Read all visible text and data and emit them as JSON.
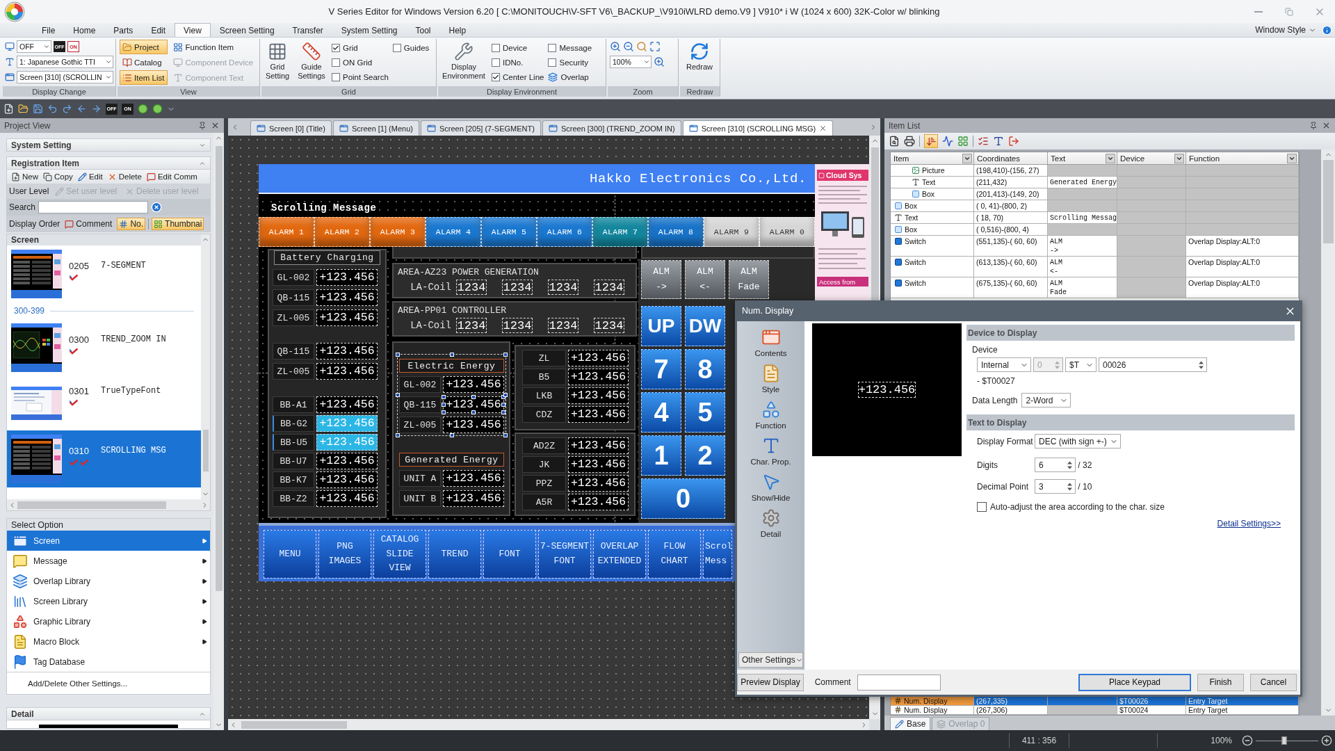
{
  "window": {
    "title": "V Series Editor for Windows Version 6.20 [ C:\\MONITOUCH\\V-SFT V6\\_BACKUP_\\V910iWLRD demo.V9 ] V910* i W (1024 x 600) 32K-Color w/ blinking"
  },
  "menu": {
    "items": [
      {
        "label": "File",
        "selected": false
      },
      {
        "label": "Home",
        "selected": false
      },
      {
        "label": "Parts",
        "selected": false
      },
      {
        "label": "Edit",
        "selected": false
      },
      {
        "label": "View",
        "selected": true
      },
      {
        "label": "Screen Setting",
        "selected": false
      },
      {
        "label": "Transfer",
        "selected": false
      },
      {
        "label": "System Setting",
        "selected": false
      },
      {
        "label": "Tool",
        "selected": false
      },
      {
        "label": "Help",
        "selected": false
      }
    ],
    "window_style": "Window Style"
  },
  "ribbon": {
    "display_change": {
      "label": "Display Change",
      "blink": "OFF",
      "toggles": [
        "OFF",
        "ON"
      ],
      "font": "1: Japanese Gothic TTI",
      "screen": "Screen [310] (SCROLLIN"
    },
    "view": {
      "label": "View",
      "items": [
        {
          "label": "Project",
          "kind": "project",
          "selected": true,
          "disabled": false
        },
        {
          "label": "Catalog",
          "kind": "catalog",
          "selected": false,
          "disabled": false
        },
        {
          "label": "Item List",
          "kind": "list",
          "selected": true,
          "disabled": false
        },
        {
          "label": "Function Item",
          "kind": "function",
          "selected": false,
          "disabled": false
        },
        {
          "label": "Component Device",
          "kind": "device",
          "selected": false,
          "disabled": true
        },
        {
          "label": "Component Text",
          "kind": "text",
          "selected": false,
          "disabled": true
        }
      ]
    },
    "grid": {
      "label": "Grid",
      "buttons": [
        {
          "label": "Grid Setting",
          "kind": "grid"
        },
        {
          "label": "Guide Settings",
          "kind": "guide"
        }
      ],
      "checks": [
        {
          "label": "Grid",
          "checked": true
        },
        {
          "label": "ON Grid",
          "checked": false
        },
        {
          "label": "Point Search",
          "checked": false
        },
        {
          "label": "Guides",
          "checked": false
        }
      ]
    },
    "display_environment": {
      "label": "Display Environment",
      "button": "Display Environment",
      "checks": [
        {
          "label": "Device",
          "checked": false
        },
        {
          "label": "IDNo.",
          "checked": false
        },
        {
          "label": "Center Line",
          "checked": true
        },
        {
          "label": "Message",
          "checked": false
        },
        {
          "label": "Security",
          "checked": false
        }
      ],
      "overlap": "Overlap"
    },
    "zoom": {
      "label": "Zoom",
      "value": "100%"
    },
    "redraw": {
      "label": "Redraw",
      "button": "Redraw"
    }
  },
  "quick_toolbar": {
    "toggles": [
      "OFF",
      "ON"
    ]
  },
  "project_view": {
    "title": "Project View",
    "system_setting": {
      "title": "System Setting",
      "expanded": false
    },
    "registration": {
      "title": "Registration Item",
      "expanded": true,
      "tools": [
        {
          "label": "New",
          "kind": "new"
        },
        {
          "label": "Copy",
          "kind": "copy"
        },
        {
          "label": "Edit",
          "kind": "edit"
        },
        {
          "label": "Delete",
          "kind": "delete"
        },
        {
          "label": "Edit Comm",
          "kind": "comment"
        }
      ],
      "user_level": {
        "label": "User Level",
        "tools": [
          {
            "label": "Set user level",
            "kind": "edit",
            "disabled": true
          },
          {
            "label": "Delete user level",
            "kind": "delete",
            "disabled": true
          }
        ]
      },
      "search": {
        "label": "Search"
      },
      "display_order": {
        "label": "Display Order",
        "options": [
          {
            "label": "Comment",
            "kind": "comment",
            "selected": false
          },
          {
            "label": "No.",
            "kind": "number",
            "selected": true
          },
          {
            "label": "Thumbnai",
            "kind": "thumbnail",
            "selected": true
          }
        ]
      }
    },
    "screens": {
      "title": "Screen",
      "items": [
        {
          "kind": "screen",
          "number": "0205",
          "name": "7-SEGMENT",
          "thumbnail": {
            "kind": "dark"
          },
          "selected": false,
          "second_flag": false
        },
        {
          "kind": "group",
          "label": "300-399"
        },
        {
          "kind": "screen",
          "number": "0300",
          "name": "TREND_ZOOM IN",
          "thumbnail": {
            "kind": "chart"
          },
          "selected": false,
          "second_flag": false
        },
        {
          "kind": "screen",
          "number": "0301",
          "name": "TrueTypeFont",
          "thumbnail": {
            "kind": "light"
          },
          "selected": false,
          "second_flag": false
        },
        {
          "kind": "screen",
          "number": "0310",
          "name": "SCROLLING MSG",
          "thumbnail": {
            "kind": "dark"
          },
          "selected": true,
          "second_flag": true
        }
      ]
    },
    "select_option": {
      "title": "Select Option",
      "items": [
        {
          "label": "Screen",
          "kind": "screen",
          "selected": true,
          "submenu": true
        },
        {
          "label": "Message",
          "kind": "message",
          "selected": false,
          "submenu": true
        },
        {
          "label": "Overlap Library",
          "kind": "overlap",
          "selected": false,
          "submenu": true
        },
        {
          "label": "Screen Library",
          "kind": "screen_library",
          "selected": false,
          "submenu": true
        },
        {
          "label": "Graphic Library",
          "kind": "graphic",
          "selected": false,
          "submenu": true
        },
        {
          "label": "Macro Block",
          "kind": "macro",
          "selected": false,
          "submenu": true
        },
        {
          "label": "Tag Database",
          "kind": "tag",
          "selected": false,
          "submenu": false
        }
      ],
      "footer": "Add/Delete Other Settings..."
    },
    "detail": {
      "title": "Detail",
      "expanded": true
    }
  },
  "editor": {
    "tabs": [
      {
        "label": "Screen [0] (Title)",
        "selected": false
      },
      {
        "label": "Screen [1] (Menu)",
        "selected": false
      },
      {
        "label": "Screen [205] (7-SEGMENT)",
        "selected": false
      },
      {
        "label": "Screen [300] (TREND_ZOOM IN)",
        "selected": false
      },
      {
        "label": "Screen [310] (SCROLLING MSG)",
        "selected": true
      }
    ],
    "hmi": {
      "header": "Hakko Electronics Co.,Ltd.",
      "subtitle": "Scrolling Message",
      "alarms": [
        {
          "label": "ALARM 1",
          "color": "#e2680f"
        },
        {
          "label": "ALARM 2",
          "color": "#e2680f"
        },
        {
          "label": "ALARM 3",
          "color": "#e2680f"
        },
        {
          "label": "ALARM 4",
          "color": "#1a78d0"
        },
        {
          "label": "ALARM 5",
          "color": "#1a78d0"
        },
        {
          "label": "ALARM 6",
          "color": "#1a78d0"
        },
        {
          "label": "ALARM 7",
          "color": "#13879e"
        },
        {
          "label": "ALARM 8",
          "color": "#1873c9"
        },
        {
          "label": "ALARM 9",
          "color": "#d6d6d6"
        },
        {
          "label": "ALARM 0",
          "color": "#d6d6d6"
        }
      ],
      "battery": {
        "title": "Battery Charging",
        "groups": [
          {
            "rows": [
              {
                "label": "GL-002",
                "value": "+123.456",
                "highlighted": false
              },
              {
                "label": "QB-115",
                "value": "+123.456",
                "highlighted": false
              },
              {
                "label": "ZL-005",
                "value": "+123.456",
                "highlighted": false
              }
            ]
          },
          {
            "rows": [
              {
                "label": "QB-115",
                "value": "+123.456",
                "highlighted": false
              },
              {
                "label": "ZL-005",
                "value": "+123.456",
                "highlighted": false
              }
            ]
          },
          {
            "rows": [
              {
                "label": "BB-A1",
                "value": "+123.456",
                "highlighted": false
              },
              {
                "label": "BB-G2",
                "value": "+123.456",
                "highlighted": true
              },
              {
                "label": "BB-U5",
                "value": "+123.456",
                "highlighted": true
              },
              {
                "label": "BB-U7",
                "value": "+123.456",
                "highlighted": false
              },
              {
                "label": "BB-K7",
                "value": "+123.456",
                "highlighted": false
              },
              {
                "label": "BB-Z2",
                "value": "+123.456",
                "highlighted": false
              }
            ]
          }
        ]
      },
      "areas": [
        {
          "title": "AREA-AZ23 POWER GENERATION",
          "label": "LA-Coil",
          "values": [
            "1234",
            "1234",
            "1234",
            "1234"
          ]
        },
        {
          "title": "AREA-PP01 CONTROLLER",
          "label": "LA-Coil",
          "values": [
            "1234",
            "1234",
            "1234",
            "1234"
          ]
        }
      ],
      "energy": [
        {
          "title": "Electric Energy",
          "selected": true,
          "rows": [
            {
              "label": "GL-002",
              "value": "+123.456",
              "selected": false
            },
            {
              "label": "QB-115",
              "value": "+123.456",
              "selected": true
            },
            {
              "label": "ZL-005",
              "value": "+123.456",
              "selected": false
            }
          ]
        },
        {
          "title": "Generated Energy",
          "selected": false,
          "rows": [
            {
              "label": "UNIT A",
              "value": "+123.456",
              "selected": false
            },
            {
              "label": "UNIT B",
              "value": "+123.456",
              "selected": false
            }
          ]
        }
      ],
      "value_panels": [
        {
          "rows": [
            {
              "label": "ZL",
              "value": "+123.456"
            },
            {
              "label": "B5",
              "value": "+123.456"
            },
            {
              "label": "LKB",
              "value": "+123.456"
            },
            {
              "label": "CDZ",
              "value": "+123.456"
            }
          ]
        },
        {
          "rows": [
            {
              "label": "AD2Z",
              "value": "+123.456"
            },
            {
              "label": "JK",
              "value": "+123.456"
            },
            {
              "label": "PPZ",
              "value": "+123.456"
            },
            {
              "label": "A5R",
              "value": "+123.456"
            }
          ]
        }
      ],
      "alm_buttons": [
        {
          "lines": [
            "ALM",
            "->"
          ]
        },
        {
          "lines": [
            "ALM",
            "<-"
          ]
        },
        {
          "lines": [
            "ALM",
            "Fade"
          ]
        }
      ],
      "keypad": [
        {
          "label": "UP",
          "wide": false
        },
        {
          "label": "DW",
          "wide": false
        },
        {
          "label": "7",
          "wide": false
        },
        {
          "label": "8",
          "wide": false
        },
        {
          "label": "4",
          "wide": false
        },
        {
          "label": "5",
          "wide": false
        },
        {
          "label": "1",
          "wide": false
        },
        {
          "label": "2",
          "wide": false
        },
        {
          "label": "0",
          "wide": true
        }
      ],
      "nav": [
        {
          "lines": [
            "MENU"
          ]
        },
        {
          "lines": [
            "PNG",
            "IMAGES"
          ]
        },
        {
          "lines": [
            "CATALOG",
            "SLIDE",
            "VIEW"
          ]
        },
        {
          "lines": [
            "TREND"
          ]
        },
        {
          "lines": [
            "FONT"
          ]
        },
        {
          "lines": [
            "7-SEGMENT",
            "FONT"
          ]
        },
        {
          "lines": [
            "OVERLAP",
            "EXTENDED"
          ]
        },
        {
          "lines": [
            "FLOW",
            "CHART"
          ]
        },
        {
          "lines": [
            "Scrol",
            "Mess"
          ]
        }
      ],
      "side_panel": {
        "title": "Cloud Sys",
        "footer": "Access from"
      }
    }
  },
  "item_list": {
    "title": "Item List",
    "sort_selected": true,
    "columns": [
      {
        "label": "Item",
        "filter": true
      },
      {
        "label": "Coordinates",
        "filter": false
      },
      {
        "label": "Text",
        "filter": true
      },
      {
        "label": "Device",
        "filter": true
      },
      {
        "label": "Function",
        "filter": true
      }
    ],
    "rows": [
      {
        "children": [
          {
            "item": "Picture",
            "kind": "picture",
            "coordinates": "(198,410)-(156, 27)",
            "selected": false
          },
          {
            "item": "Text",
            "kind": "text",
            "coordinates": "(211,432)",
            "text": "Generated Energy",
            "selected": false
          },
          {
            "item": "Box",
            "kind": "box",
            "coordinates": "(201,413)-(149, 20)",
            "selected": false
          }
        ]
      },
      {
        "item": "Box",
        "kind": "box",
        "coordinates": "( 0, 41)-(800, 2)",
        "selected": false
      },
      {
        "item": "Text",
        "kind": "text",
        "coordinates": "( 18, 70)",
        "text": "Scrolling Messag",
        "selected": false
      },
      {
        "item": "Box",
        "kind": "box",
        "coordinates": "( 0,516)-(800, 4)",
        "selected": false
      },
      {
        "item": "Switch",
        "kind": "switch",
        "coordinates": "(551,135)-( 60, 60)",
        "text": "ALM\n->",
        "function": "Overlap Display:ALT:0",
        "selected": false
      },
      {
        "item": "Switch",
        "kind": "switch",
        "coordinates": "(613,135)-( 60, 60)",
        "text": "ALM\n<-",
        "function": "Overlap Display:ALT:0",
        "selected": false
      },
      {
        "item": "Switch",
        "kind": "switch",
        "coordinates": "(675,135)-( 60, 60)",
        "text": "ALM\nFade",
        "function": "Overlap Display:ALT:0",
        "selected": false
      }
    ],
    "bottom_rows": [
      {
        "item": "Num. Display",
        "kind": "num",
        "coordinates": "(267,335)",
        "device": "$T00026",
        "function": "Entry Target",
        "selected": true
      },
      {
        "item": "Num. Display",
        "kind": "num",
        "coordinates": "(267,306)",
        "device": "$T00024",
        "function": "Entry Target",
        "selected": false
      }
    ],
    "tabs": [
      {
        "label": "Base",
        "selected": true,
        "disabled": false
      },
      {
        "label": "Overlap 0",
        "selected": false,
        "disabled": true
      }
    ]
  },
  "dialog": {
    "title": "Num. Display",
    "nav": [
      {
        "label": "Contents",
        "kind": "contents"
      },
      {
        "label": "Style",
        "kind": "style"
      },
      {
        "label": "Function",
        "kind": "function"
      },
      {
        "label": "Char. Prop.",
        "kind": "char"
      },
      {
        "label": "Show/Hide",
        "kind": "show_hide"
      },
      {
        "label": "Detail",
        "kind": "detail"
      }
    ],
    "other_settings": "Other Settings",
    "preview": "+123.456",
    "device_section": "Device to Display",
    "device_label": "Device",
    "device": {
      "type": "Internal",
      "station": "0",
      "station_disabled": true,
      "prefix": "$T",
      "address": "00026",
      "range_end": "- $T00027"
    },
    "data_length": {
      "label": "Data Length",
      "value": "2-Word"
    },
    "text_section": "Text to Display",
    "format": {
      "label": "Display Format",
      "value": "DEC (with sign +-)"
    },
    "digits": {
      "label": "Digits",
      "value": "6",
      "max": "/ 32"
    },
    "decimal": {
      "label": "Decimal Point",
      "value": "3",
      "max": "/ 10"
    },
    "auto_adjust": {
      "label": "Auto-adjust the area according to the char. size",
      "checked": false
    },
    "detail_link": "Detail Settings>>",
    "preview_button": "Preview Display",
    "comment_label": "Comment",
    "buttons": [
      {
        "label": "Place Keypad",
        "default": true
      },
      {
        "label": "Finish",
        "default": false
      },
      {
        "label": "Cancel",
        "default": false
      }
    ]
  },
  "status_bar": {
    "position": "411 : 356",
    "zoom": "100%",
    "zoom_slider": {
      "level": 0.45
    }
  }
}
